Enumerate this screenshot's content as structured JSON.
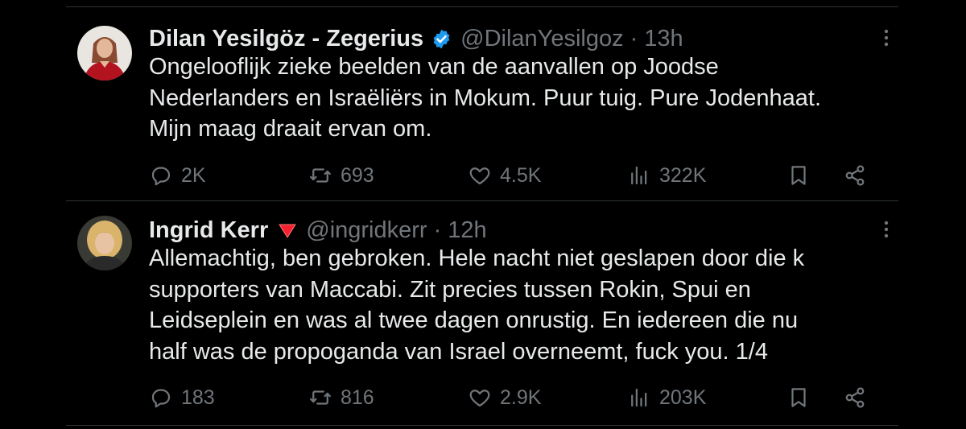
{
  "tweets": [
    {
      "name": "Dilan Yesilgöz - Zegerius",
      "verified": true,
      "flag_emoji": "",
      "handle": "@DilanYesilgoz",
      "separator": "·",
      "time": "13h",
      "text_lines": [
        "Ongelooflijk zieke beelden van de aanvallen op Joodse",
        "Nederlanders en Israëliërs in Mokum. Puur tuig. Pure Jodenhaat.",
        "Mijn maag draait ervan om."
      ],
      "replies": "2K",
      "reposts": "693",
      "likes": "4.5K",
      "views": "322K"
    },
    {
      "name": "Ingrid Kerr",
      "verified": false,
      "flag_emoji": "red-triangle-icon",
      "handle": "@ingridkerr",
      "separator": "·",
      "time": "12h",
      "text_lines": [
        "Allemachtig, ben gebroken. Hele nacht niet geslapen door die k",
        "supporters van Maccabi. Zit precies tussen Rokin, Spui en",
        "Leidseplein en was al twee dagen onrustig. En iedereen die nu",
        "half was de propoganda van Israel overneemt, fuck you. 1/4"
      ],
      "replies": "183",
      "reposts": "816",
      "likes": "2.9K",
      "views": "203K"
    }
  ],
  "colors": {
    "background": "#000000",
    "text": "#e7e9ea",
    "secondary": "#71767b",
    "verified": "#1d9bf0",
    "divider": "#2f3336",
    "flag_red": "#f4212e"
  }
}
